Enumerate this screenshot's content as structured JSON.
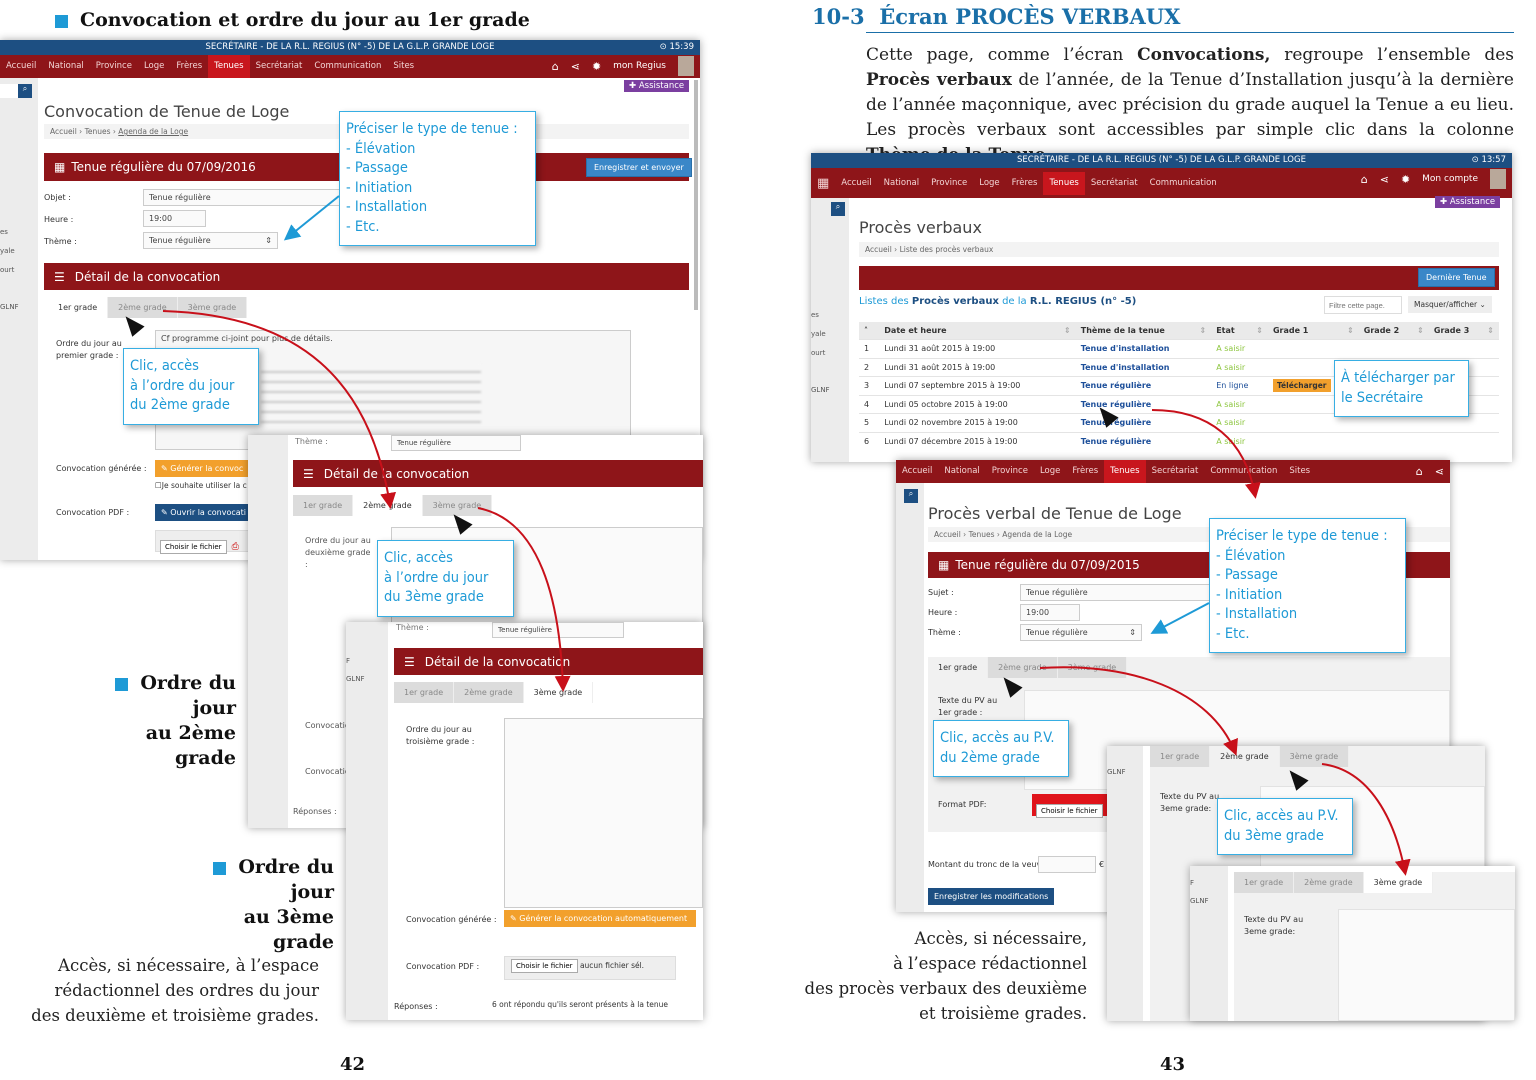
{
  "colors": {
    "accent_blue": "#1e9ad6",
    "nav_red": "#8e1519",
    "topbar_blue": "#1d4f82",
    "arrow_red": "#c8101a",
    "orange": "#f2a02c"
  },
  "left_page": {
    "heading": "Convocation et ordre du jour au 1er grade",
    "subheading_2": [
      "Ordre du jour",
      "au 2ème grade"
    ],
    "subheading_3": [
      "Ordre du jour",
      "au 3ème grade"
    ],
    "footer_text": [
      "Accès, si nécessaire, à l’espace",
      "rédactionnel des ordres du jour",
      "des deuxième et troisième grades."
    ],
    "page_number": "42"
  },
  "right_page": {
    "section_number": "10-3",
    "section_title": "Écran PROCÈS VERBAUX",
    "intro": {
      "p1": "Cette page, comme l’écran ",
      "b1": "Convocations,",
      "p2": " regroupe l’ensemble des ",
      "b2": "Procès verbaux",
      "p3": " de l’année, de la Tenue d’Installation jusqu’à la dernière de l’année maçonnique, avec précision du grade auquel la Tenue a eu lieu. Les procès verbaux sont accessibles par simple clic dans la colonne ",
      "b3": "Thème de la Tenue",
      "p4": "."
    },
    "footer_text": [
      "Accès, si nécessaire,",
      "à l’espace rédactionnel",
      "des procès verbaux des deuxième",
      "et troisième grades."
    ],
    "page_number": "43"
  },
  "app": {
    "topbar_title": "SECRÉTAIRE - DE LA R.L. REGIUS (N° -5) DE LA G.L.P. GRANDE LOGE",
    "clock_a": "⊙ 15:39",
    "clock_b": "⊙ 13:57",
    "nav": [
      "Accueil",
      "National",
      "Province",
      "Loge",
      "Frères",
      "Tenues",
      "Secrétariat",
      "Communication",
      "Sites"
    ],
    "nav_active": "Tenues",
    "nav_icons": [
      "home-icon",
      "share-icon",
      "gear-icon"
    ],
    "account_a": "mon Regius",
    "account_b": "Mon compte",
    "assistance": "Assistance",
    "sidebar_fragments": [
      "es",
      "yale",
      "ourt",
      "F",
      "GLNF"
    ]
  },
  "convocation": {
    "title": "Convocation de Tenue de Loge",
    "breadcrumb": [
      "Accueil",
      "Tenues",
      "Agenda de la Loge"
    ],
    "tenue_header": "Tenue régulière du 07/09/2016",
    "save_send": "Enregistrer et envoyer",
    "objet_label": "Objet :",
    "objet_value": "Tenue régulière",
    "heure_label": "Heure :",
    "heure_value": "19:00",
    "theme_label": "Thème :",
    "theme_value": "Tenue régulière",
    "detail_header": "Détail de la convocation",
    "tabs": [
      "1er grade",
      "2ème grade",
      "3ème grade"
    ],
    "odj1_label": "Ordre du jour au premier grade :",
    "odj1_text": "Cf programme ci-joint pour plus de détails.",
    "odj2_label": "Ordre du jour au deuxième grade :",
    "odj3_label": "Ordre du jour au troisième grade :",
    "generated_label": "Convocation générée :",
    "generate_btn": "Générer la convocation automatiquement",
    "generate_btn_short": "Générer la convoc",
    "use_glnf": "Je souhaite utiliser la c",
    "pdf_label": "Convocation PDF :",
    "open_btn": "Ouvrir la convocati",
    "choose_file": "Choisir le fichier",
    "no_file": "aucun fichier sél.",
    "responses_label": "Réponses :",
    "responses_text": "6 ont répondu qu'ils seront présents à la tenue"
  },
  "pv_list": {
    "title": "Procès verbaux",
    "breadcrumb": [
      "Accueil",
      "Liste des procès verbaux"
    ],
    "last_btn": "Dernière Tenue",
    "list_title": {
      "a": "Listes des ",
      "b": "Procès verbaux",
      "c": " de la ",
      "d": "R.L. REGIUS (n° -5)"
    },
    "filter_placeholder": "Filtre cette page.",
    "toggle_btn": "Masquer/afficher",
    "columns": [
      "Date et heure",
      "Thème de la tenue",
      "Etat",
      "Grade 1",
      "Grade 2",
      "Grade 3"
    ],
    "rows": [
      {
        "n": "1",
        "date": "Lundi 31 août 2015 à 19:00",
        "theme": "Tenue d'installation",
        "etat": "A saisir",
        "g1": ""
      },
      {
        "n": "2",
        "date": "Lundi 31 août 2015 à 19:00",
        "theme": "Tenue d'installation",
        "etat": "A saisir",
        "g1": ""
      },
      {
        "n": "3",
        "date": "Lundi 07 septembre 2015 à 19:00",
        "theme": "Tenue régulière",
        "etat": "En ligne",
        "g1": "Télécharger"
      },
      {
        "n": "4",
        "date": "Lundi 05 octobre 2015 à 19:00",
        "theme": "Tenue régulière",
        "etat": "A saisir",
        "g1": ""
      },
      {
        "n": "5",
        "date": "Lundi 02 novembre 2015 à 19:00",
        "theme": "Tenue régulière",
        "etat": "A saisir",
        "g1": ""
      },
      {
        "n": "6",
        "date": "Lundi 07 décembre 2015 à 19:00",
        "theme": "Tenue régulière",
        "etat": "A saisir",
        "g1": ""
      }
    ]
  },
  "pv_edit": {
    "title": "Procès verbal de Tenue de Loge",
    "breadcrumb": [
      "Accueil",
      "Tenues",
      "Agenda de la Loge"
    ],
    "tenue_header": "Tenue régulière du 07/09/2015",
    "sujet_label": "Sujet :",
    "sujet_value": "Tenue régulière",
    "heure_label": "Heure :",
    "heure_value": "19:00",
    "theme_label": "Thème :",
    "theme_value": "Tenue régulière",
    "tabs": [
      "1er grade",
      "2ème grade",
      "3ème grade"
    ],
    "texte1_label": "Texte du PV au 1er grade :",
    "texte3_label": "Texte du PV au 3eme grade:",
    "pdf_label": "Format PDF:",
    "choose_file": "Choisir le fichier",
    "tronc_label": "Montant du tronc de la veuve :",
    "currency": "€",
    "save_btn": "Enregistrer les modifications"
  },
  "callouts": {
    "type_tenue": [
      "Préciser le type de tenue :",
      "- Élévation",
      "- Passage",
      "- Initiation",
      "- Installation",
      "- Etc."
    ],
    "odj2": [
      "Clic, accès",
      "à l’ordre du jour",
      "du 2ème grade"
    ],
    "odj3": [
      "Clic, accès",
      "à l’ordre du jour",
      "du 3ème grade"
    ],
    "download": [
      "À télécharger par",
      "le Secrétaire"
    ],
    "pv2": [
      "Clic, accès au P.V.",
      "du 2ème grade"
    ],
    "pv3": [
      "Clic, accès au P.V.",
      "du 3ème grade"
    ]
  }
}
